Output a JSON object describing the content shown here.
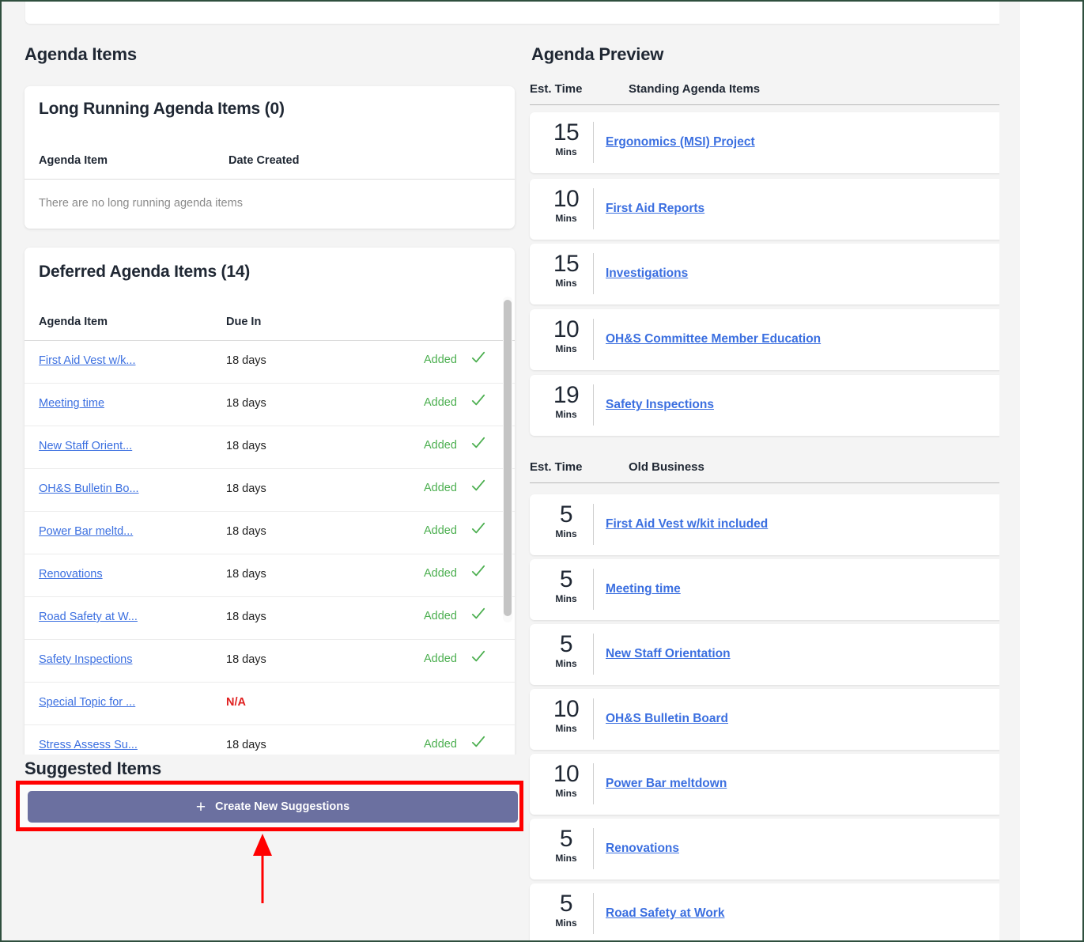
{
  "left": {
    "section_title": "Agenda Items",
    "long_running": {
      "title": "Long Running Agenda Items (0)",
      "columns": {
        "item": "Agenda Item",
        "date": "Date Created"
      },
      "empty_message": "There are no long running agenda items"
    },
    "deferred": {
      "title": "Deferred Agenda Items (14)",
      "columns": {
        "item": "Agenda Item",
        "due": "Due In"
      },
      "rows": [
        {
          "item": "First Aid Vest w/k...",
          "due": "18 days",
          "status": "Added",
          "na": false
        },
        {
          "item": "Meeting time",
          "due": "18 days",
          "status": "Added",
          "na": false
        },
        {
          "item": "New Staff Orient...",
          "due": "18 days",
          "status": "Added",
          "na": false
        },
        {
          "item": "OH&S Bulletin Bo...",
          "due": "18 days",
          "status": "Added",
          "na": false
        },
        {
          "item": "Power Bar meltd...",
          "due": "18 days",
          "status": "Added",
          "na": false
        },
        {
          "item": "Renovations",
          "due": "18 days",
          "status": "Added",
          "na": false
        },
        {
          "item": "Road Safety at W...",
          "due": "18 days",
          "status": "Added",
          "na": false
        },
        {
          "item": "Safety Inspections",
          "due": "18 days",
          "status": "Added",
          "na": false
        },
        {
          "item": "Special Topic for ...",
          "due": "N/A",
          "status": "",
          "na": true
        },
        {
          "item": "Stress Assess Su...",
          "due": "18 days",
          "status": "Added",
          "na": false
        }
      ]
    },
    "suggested": {
      "title": "Suggested Items",
      "create_button_label": "Create New Suggestions",
      "plus_icon": "+"
    }
  },
  "right": {
    "section_title": "Agenda Preview",
    "groups": [
      {
        "est_time_label": "Est. Time",
        "name": "Standing Agenda Items",
        "items": [
          {
            "mins": "15",
            "unit": "Mins",
            "label": "Ergonomics (MSI) Project"
          },
          {
            "mins": "10",
            "unit": "Mins",
            "label": "First Aid Reports"
          },
          {
            "mins": "15",
            "unit": "Mins",
            "label": "Investigations"
          },
          {
            "mins": "10",
            "unit": "Mins",
            "label": "OH&S Committee Member Education"
          },
          {
            "mins": "19",
            "unit": "Mins",
            "label": "Safety Inspections"
          }
        ]
      },
      {
        "est_time_label": "Est. Time",
        "name": "Old Business",
        "items": [
          {
            "mins": "5",
            "unit": "Mins",
            "label": "First Aid Vest w/kit included"
          },
          {
            "mins": "5",
            "unit": "Mins",
            "label": "Meeting time"
          },
          {
            "mins": "5",
            "unit": "Mins",
            "label": "New Staff Orientation"
          },
          {
            "mins": "10",
            "unit": "Mins",
            "label": "OH&S Bulletin Board"
          },
          {
            "mins": "10",
            "unit": "Mins",
            "label": "Power Bar meltdown"
          },
          {
            "mins": "5",
            "unit": "Mins",
            "label": "Renovations"
          },
          {
            "mins": "5",
            "unit": "Mins",
            "label": "Road Safety at Work"
          }
        ]
      }
    ]
  },
  "annotation": {
    "highlight_color": "#ff0000",
    "arrow_color": "#ff0000"
  },
  "colors": {
    "button": "#6b70a0",
    "link": "#3b6fe0",
    "added": "#4caf50",
    "na": "#e02020",
    "page_bg": "#f4f4f4",
    "frame": "#2f4f3e"
  }
}
